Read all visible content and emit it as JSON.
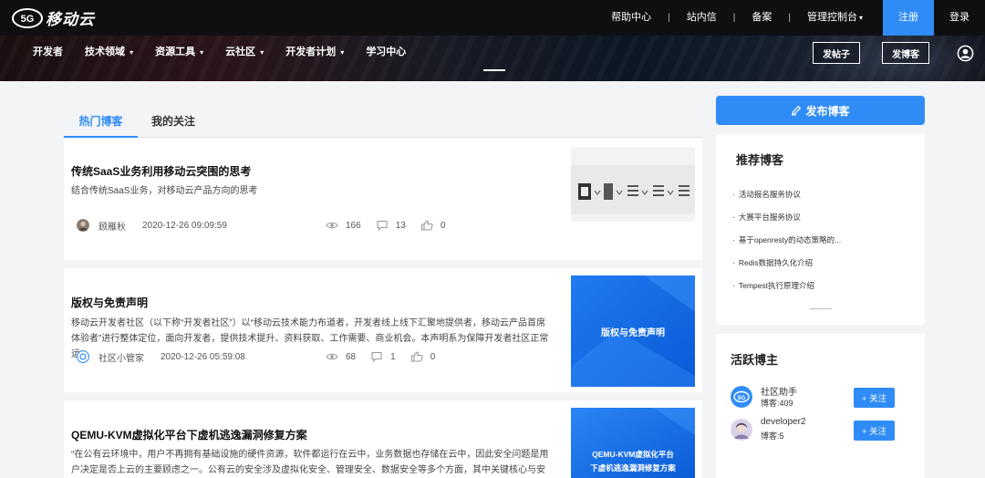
{
  "brand": {
    "logo_text": "移动云",
    "logo_badge": "5G"
  },
  "topnav": {
    "items": [
      "帮助中心",
      "站内信",
      "备案"
    ],
    "console": "管理控制台",
    "register": "注册",
    "login": "登录",
    "separator": "|"
  },
  "mainnav": {
    "items": [
      {
        "label": "开发者",
        "dropdown": false
      },
      {
        "label": "技术领域",
        "dropdown": true
      },
      {
        "label": "资源工具",
        "dropdown": true
      },
      {
        "label": "云社区",
        "dropdown": true
      },
      {
        "label": "开发者计划",
        "dropdown": true
      },
      {
        "label": "学习中心",
        "dropdown": false
      }
    ],
    "post_button": "发帖子",
    "blog_button": "发博客",
    "caret": "▾"
  },
  "tabs": {
    "hot": "热门博客",
    "follow": "我的关注"
  },
  "articles": [
    {
      "title": "传统SaaS业务利用移动云突围的思考",
      "summary": "结合传统SaaS业务，对移动云产品方向的思考",
      "author": "顾雁秋",
      "time": "2020-12-26 09:09:59",
      "views": "166",
      "comments": "13",
      "likes": "0"
    },
    {
      "title": "版权与免责声明",
      "summary": "移动云开发者社区（以下称“开发者社区”）以“移动云技术能力布道者，开发者线上线下汇聚地提供者，移动云产品首席体验者”进行整体定位，面向开发者，提供技术提升、资料获取、工作需要、商业机会。本声明系为保障开发者社区正常运...",
      "author": "社区小管家",
      "time": "2020-12-26 05:59:08",
      "views": "68",
      "comments": "1",
      "likes": "0",
      "thumb_text": "版权与免责声明"
    },
    {
      "title": "QEMU-KVM虚拟化平台下虚机逃逸漏洞修复方案",
      "summary": "“在公有云环境中，用户不再拥有基础设施的硬件资源，软件都运行在云中，业务数据也存储在云中，因此安全问题是用户决定是否上云的主要顾虑之一。公有云的安全涉及虚拟化安全、管理安全、数据安全等多个方面，其中关键核心与安全...",
      "thumb_line1": "QEMU-KVM虚拟化平台",
      "thumb_line2": "下虚机逃逸漏洞修复方案"
    }
  ],
  "sidebar": {
    "publish": "发布博客",
    "recommended_title": "推荐博客",
    "recommended": [
      "活动报名服务协议",
      "大赛平台服务协议",
      "基于openresty的动态策略的...",
      "Redis数据持久化介绍",
      "Tempest执行原理介绍"
    ],
    "active_title": "活跃博主",
    "bloggers": [
      {
        "name": "社区助手",
        "count": "博客:409",
        "follow": "+ 关注"
      },
      {
        "name": "developer2",
        "count": "博客:5",
        "follow": "+ 关注"
      }
    ]
  },
  "colors": {
    "accent": "#2f8cf6",
    "topbar": "#0f0f12"
  }
}
